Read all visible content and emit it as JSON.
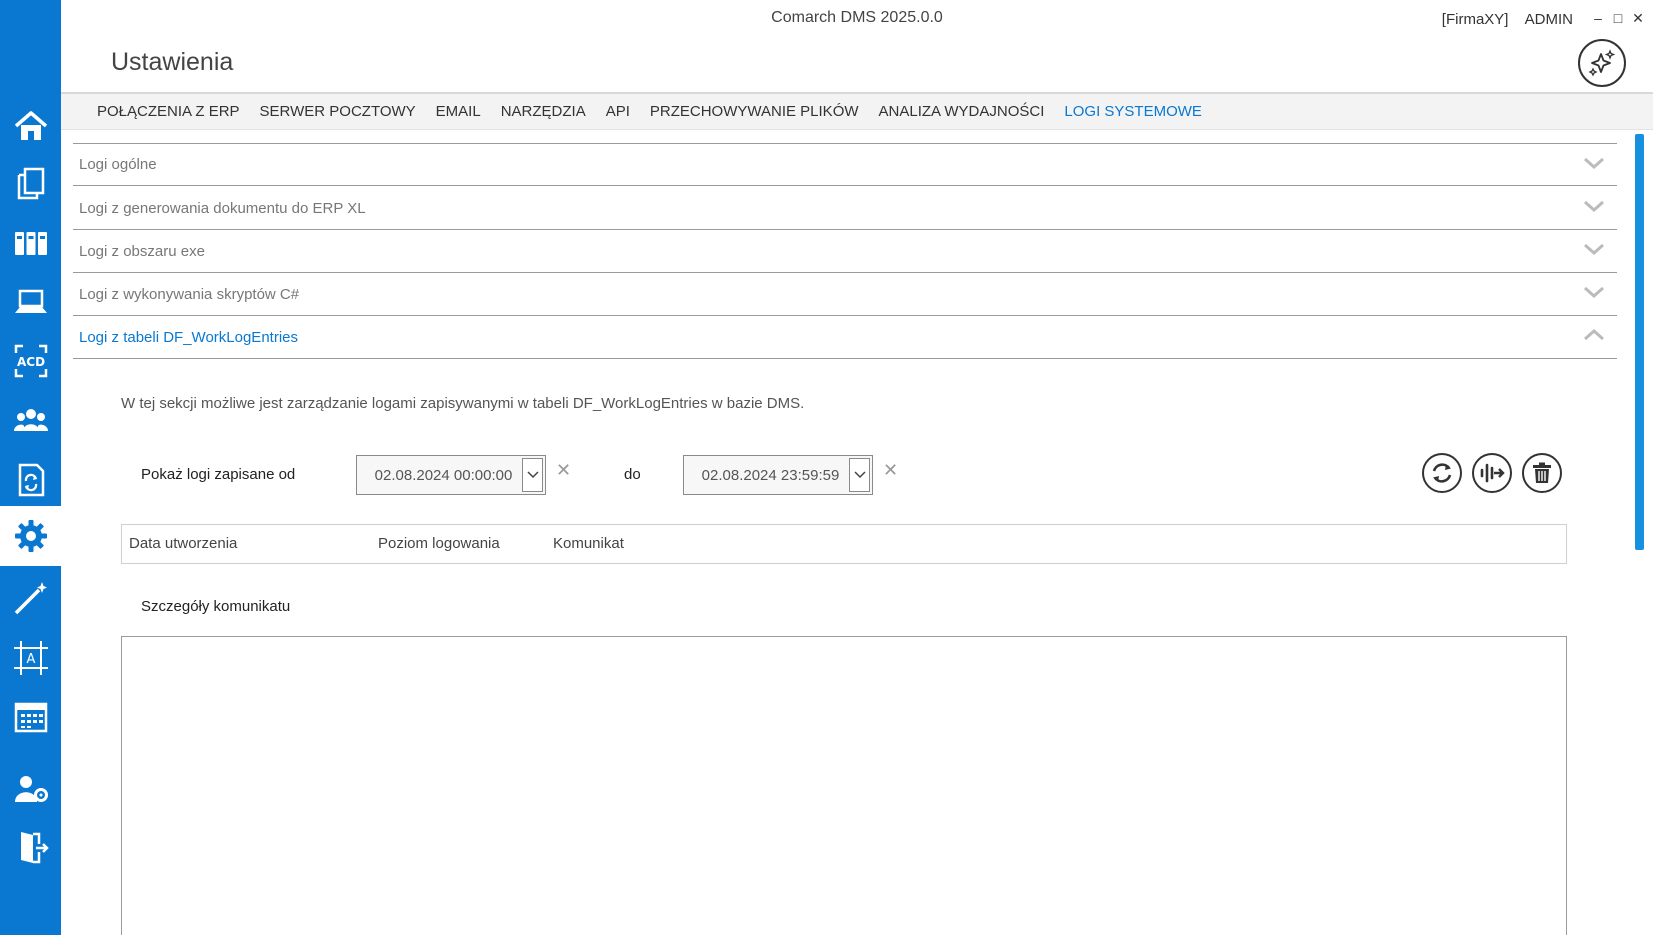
{
  "window": {
    "title": "Comarch DMS 2025.0.0",
    "company": "[FirmaXY]",
    "user": "ADMIN",
    "minimize": "–",
    "maximize": "□",
    "close": "✕"
  },
  "page": {
    "title": "Ustawienia"
  },
  "sidebar": {
    "items": [
      {
        "icon": "home-icon"
      },
      {
        "icon": "documents-icon"
      },
      {
        "icon": "repository-icon"
      },
      {
        "icon": "workstation-icon"
      },
      {
        "icon": "ocr-icon"
      },
      {
        "icon": "users-icon"
      },
      {
        "icon": "document-sync-icon"
      },
      {
        "icon": "settings-icon",
        "active": true
      },
      {
        "icon": "wizard-icon"
      },
      {
        "icon": "designer-icon"
      },
      {
        "icon": "calendar-icon"
      },
      {
        "icon": "admin-settings-icon"
      },
      {
        "icon": "logout-icon"
      }
    ]
  },
  "tabs": [
    {
      "label": "POŁĄCZENIA Z ERP"
    },
    {
      "label": "SERWER POCZTOWY"
    },
    {
      "label": "EMAIL"
    },
    {
      "label": "NARZĘDZIA"
    },
    {
      "label": "API"
    },
    {
      "label": "PRZECHOWYWANIE PLIKÓW"
    },
    {
      "label": "ANALIZA WYDAJNOŚCI"
    },
    {
      "label": "LOGI SYSTEMOWE",
      "active": true
    }
  ],
  "sections": [
    {
      "label": "Logi ogólne",
      "expanded": false
    },
    {
      "label": "Logi z generowania dokumentu do ERP XL",
      "expanded": false
    },
    {
      "label": "Logi z obszaru exe",
      "expanded": false
    },
    {
      "label": "Logi z wykonywania skryptów C#",
      "expanded": false
    },
    {
      "label": "Logi z tabeli DF_WorkLogEntries",
      "expanded": true
    }
  ],
  "worklog": {
    "description": "W tej sekcji możliwe jest zarządzanie logami zapisywanymi w tabeli DF_WorkLogEntries w bazie DMS.",
    "from_label": "Pokaż logi zapisane od",
    "from_value": "02.08.2024 00:00:00",
    "to_label": "do",
    "to_value": "02.08.2024 23:59:59",
    "clear_symbol": "✕",
    "columns": [
      "Data utworzenia",
      "Poziom logowania",
      "Komunikat"
    ],
    "details_label": "Szczegóły komunikatu",
    "details_value": ""
  },
  "colors": {
    "accent": "#0a78d0",
    "sidebar": "#0a78d0"
  }
}
